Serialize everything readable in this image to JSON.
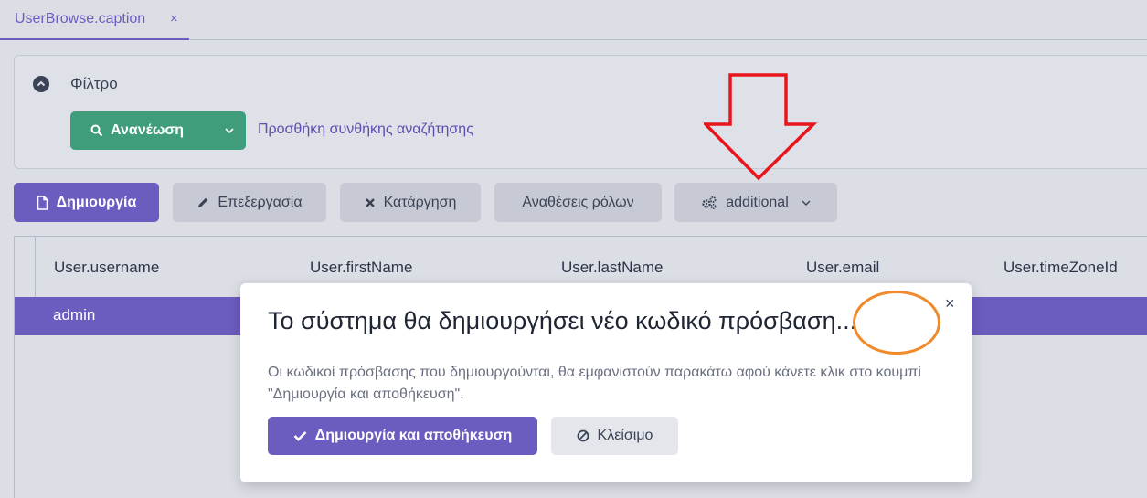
{
  "tab": {
    "label": "UserBrowse.caption",
    "close": "×"
  },
  "filter": {
    "title": "Φίλτρο",
    "refresh_label": "Ανανέωση",
    "add_condition": "Προσθήκη συνθήκης αναζήτησης"
  },
  "toolbar": {
    "create": "Δημιουργία",
    "edit": "Επεξεργασία",
    "remove": "Κατάργηση",
    "roles": "Αναθέσεις ρόλων",
    "additional": "additional"
  },
  "table": {
    "columns": [
      "User.username",
      "User.firstName",
      "User.lastName",
      "User.email",
      "User.timeZoneId"
    ],
    "rows": [
      [
        "admin"
      ]
    ]
  },
  "dialog": {
    "title": "Το σύστημα θα δημιουργήσει νέο κωδικό πρόσβαση...",
    "message": "Οι κωδικοί πρόσβασης που δημιουργούνται, θα εμφανιστούν παρακάτω αφού κάνετε κλικ στο κουμπί \"Δημιουργία και αποθήκευση\".",
    "save_label": "Δημιουργία και αποθήκευση",
    "close_label": "Κλείσιμο",
    "close_x": "×"
  },
  "colors": {
    "accent": "#6b5cc0",
    "refresh": "#3f9d7b",
    "annotation_arrow": "#e8151c",
    "annotation_circle": "#f08a2b"
  }
}
